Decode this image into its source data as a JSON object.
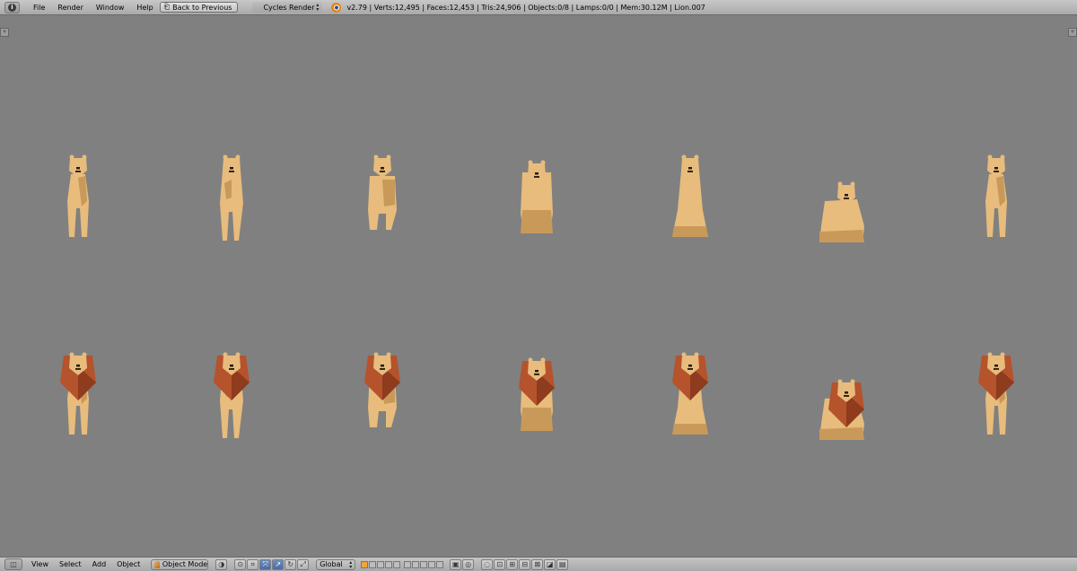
{
  "top_bar": {
    "menus": [
      "File",
      "Render",
      "Window",
      "Help"
    ],
    "back_button": "Back to Previous",
    "render_engine": "Cycles Render",
    "stats": "v2.79 | Verts:12,495 | Faces:12,453 | Tris:24,906 | Objects:0/8 | Lamps:0/0 | Mem:30.12M | Lion.007"
  },
  "viewport": {
    "background": "#808080",
    "rows": [
      {
        "type": "lioness",
        "poses": [
          "standing",
          "rearing",
          "walking",
          "crouching",
          "sitting",
          "lying",
          "standing"
        ]
      },
      {
        "type": "lion",
        "poses": [
          "standing",
          "rearing",
          "walking",
          "crouching",
          "sitting",
          "lying",
          "standing"
        ]
      }
    ]
  },
  "bottom_bar": {
    "menus": [
      "View",
      "Select",
      "Add",
      "Object"
    ],
    "mode": "Object Mode",
    "orientation": "Global"
  },
  "colors": {
    "fur": "#e7bc7c",
    "fur_shade": "#c9995a",
    "mane": "#b5532c",
    "mane_shade": "#8e3b1e"
  }
}
